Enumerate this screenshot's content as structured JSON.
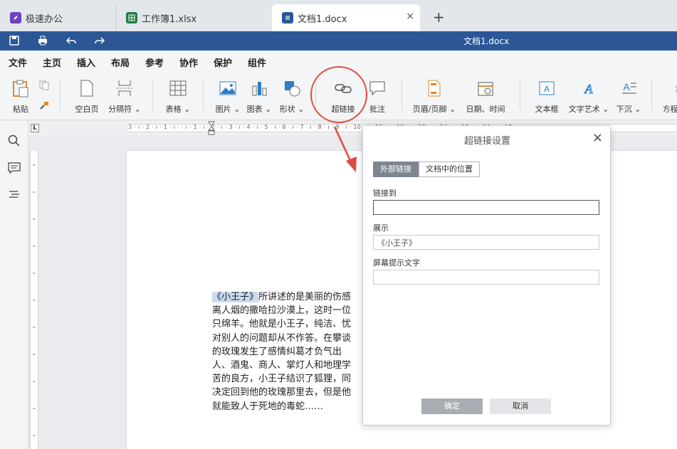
{
  "tabs": [
    {
      "label": "极速办公",
      "icon": "rocket-icon",
      "color": "#6f42c1"
    },
    {
      "label": "工作簿1.xlsx",
      "icon": "spreadsheet-icon",
      "color": "#1e7e45"
    },
    {
      "label": "文档1.docx",
      "icon": "document-icon",
      "color": "#2b5797",
      "close": "×"
    }
  ],
  "new_tab": "+",
  "title_bar": {
    "title": "文档1.docx",
    "accent": "#2b5797"
  },
  "menu": [
    "文件",
    "主页",
    "插入",
    "布局",
    "参考",
    "协作",
    "保护",
    "组件"
  ],
  "menu_active": "插入",
  "ribbon": {
    "paste": "粘贴",
    "blank_page": "空白页",
    "separator": "分隔符",
    "table": "表格",
    "picture": "图片",
    "chart": "图表",
    "shape": "形状",
    "hyperlink": "超链接",
    "comment": "批注",
    "header_footer": "页眉/页脚",
    "date_time": "日期、时间",
    "text_box": "文本框",
    "text_art": "文字艺术",
    "drop_cap": "下沉",
    "cutoff": "方程"
  },
  "ruler": {
    "corner": "L",
    "ticks": "3 · ı · 2 · ı · 1 · ı ·   · ı · 1 · ı · 2 · ı · 3 · ı · 4 · ı · 5 · ı · 6 · ı · 7 · ı · 8 · ı · 9 · ı · 10 · ı · 11 · ı · 12 · ı · 13 · ı · 14 · ı · 15 · ı · 16 · ı · 17"
  },
  "document": {
    "highlighted": "《小王子》",
    "lines": [
      "所讲述的是美丽的伤感",
      "离人烟的撒哈拉沙漠上，这时一位",
      "只绵羊。他就是小王子，纯洁、忧",
      "对别人的问题却从不作答。在攀谈",
      "的玫瑰发生了感情纠葛才负气出",
      "人、酒鬼、商人、掌灯人和地理学",
      "苦的良方，小王子结识了狐狸，同",
      "决定回到他的玫瑰那里去，但是他",
      "就能致人于死地的毒蛇……"
    ]
  },
  "dialog": {
    "title": "超链接设置",
    "close": "×",
    "tabs": [
      "外部链接",
      "文档中的位置"
    ],
    "link_to_label": "链接到",
    "link_to_value": "",
    "display_label": "展示",
    "display_value": "《小王子》",
    "tooltip_label": "屏幕提示文字",
    "tooltip_value": "",
    "ok": "确定",
    "cancel": "取消"
  },
  "annotation_color": "#e04a3f"
}
